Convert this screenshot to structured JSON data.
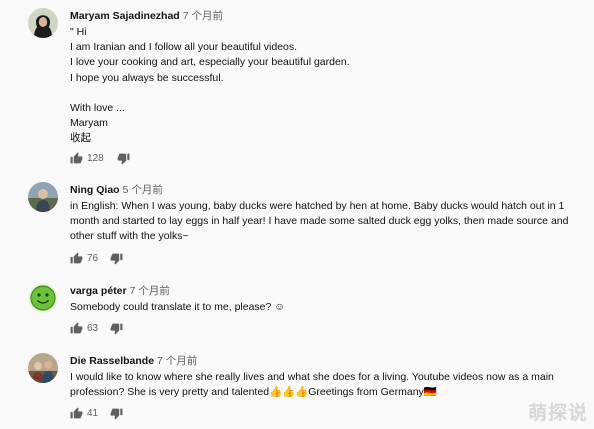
{
  "comments": [
    {
      "author": "Maryam Sajadinezhad",
      "time": "7 个月前",
      "lines": [
        "\" Hi",
        "I am Iranian and I follow all your beautiful videos.",
        "I love your cooking and art, especially your beautiful garden.",
        "I hope you always be successful.",
        "",
        "With love ...",
        "Maryam"
      ],
      "collapse_label": "收起",
      "likes": "128",
      "avatar_icon": "portrait-avatar"
    },
    {
      "author": "Ning Qiao",
      "time": "5 个月前",
      "lines": [
        "in English: When I was young, baby ducks were hatched by hen at home. Baby ducks would hatch out in 1",
        "month and started to lay eggs in half year! I have made some salted duck egg yolks, then made source and",
        "other stuff with the yolks~"
      ],
      "likes": "76",
      "avatar_icon": "photo-avatar"
    },
    {
      "author": "varga péter",
      "time": "7 个月前",
      "lines": [
        "Somebody could translate it to me, please? ☺"
      ],
      "likes": "63",
      "avatar_icon": "smiley-avatar"
    },
    {
      "author": "Die Rasselbande",
      "time": "7 个月前",
      "lines": [
        "I would like to know where she really lives and what she does for a living. Youtube videos now as a main",
        "profession? She is very pretty and talented👍👍👍Greetings from Germany🇩🇪"
      ],
      "likes": "41",
      "avatar_icon": "group-photo-avatar"
    }
  ],
  "watermark": "萌探说",
  "colors": {
    "background": "#f9f9f9",
    "meta": "#606060",
    "text": "#111111"
  }
}
